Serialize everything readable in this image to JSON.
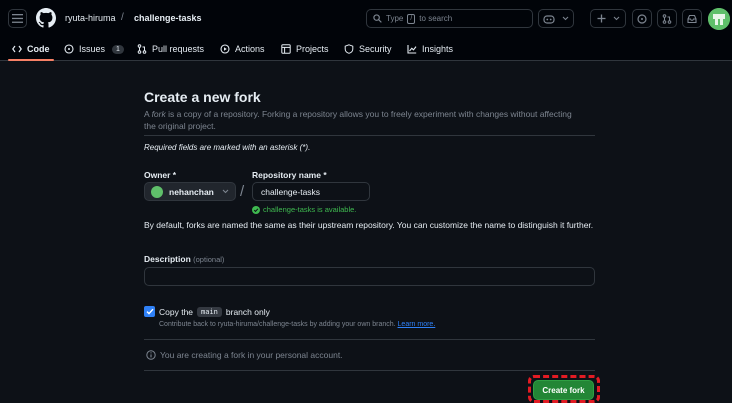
{
  "header": {
    "owner": "ryuta-hiruma",
    "separator": "/",
    "repo": "challenge-tasks",
    "search": {
      "prefix": "Type",
      "key": "/",
      "suffix": "to search"
    }
  },
  "tabs": [
    {
      "label": "Code",
      "icon": "code-icon"
    },
    {
      "label": "Issues",
      "icon": "issue-icon",
      "count": "1"
    },
    {
      "label": "Pull requests",
      "icon": "pull-request-icon"
    },
    {
      "label": "Actions",
      "icon": "play-icon"
    },
    {
      "label": "Projects",
      "icon": "table-icon"
    },
    {
      "label": "Security",
      "icon": "shield-icon"
    },
    {
      "label": "Insights",
      "icon": "graph-icon"
    }
  ],
  "form": {
    "title": "Create a new fork",
    "intro_prefix": "A ",
    "intro_em": "fork",
    "intro_suffix": " is a copy of a repository. Forking a repository allows you to freely experiment with changes without affecting the original project.",
    "required_note": "Required fields are marked with an asterisk (*).",
    "owner_label": "Owner *",
    "owner_value": "nehanchan",
    "slash": "/",
    "repo_label": "Repository name *",
    "repo_value": "challenge-tasks",
    "available_msg": "challenge-tasks is available.",
    "default_note": "By default, forks are named the same as their upstream repository. You can customize the name to distinguish it further.",
    "description_label": "Description",
    "description_optional": "(optional)",
    "description_value": "",
    "copy_prefix": "Copy the",
    "copy_code": "main",
    "copy_suffix": "branch only",
    "copy_checked": true,
    "contribute_text": "Contribute back to ryuta-hiruma/challenge-tasks by adding your own branch.",
    "learn_more": "Learn more.",
    "info_text": "You are creating a fork in your personal account.",
    "create_button": "Create fork"
  },
  "colors": {
    "background": "#0d1117",
    "header": "#010409",
    "primary_button": "#238636",
    "highlight": "#e21b23",
    "link": "#2f81f7",
    "success": "#3fb950"
  }
}
